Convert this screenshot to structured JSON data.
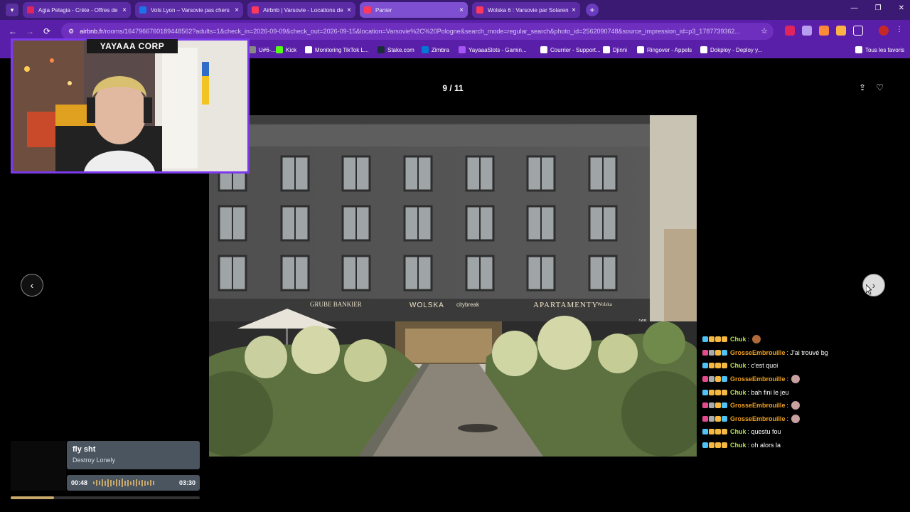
{
  "tabs": [
    {
      "label": "Agia Pelagia - Crète - Offres de",
      "color": "#e0245e",
      "active": false
    },
    {
      "label": "Vols Lyon – Varsovie pas chers",
      "color": "#1a73e8",
      "active": false
    },
    {
      "label": "Airbnb | Varsovie - Locations de",
      "color": "#ff385c",
      "active": false
    },
    {
      "label": "Panier",
      "color": "#ff385c",
      "active": true
    },
    {
      "label": "Wolska 6 : Varsovie par Solaren",
      "color": "#ff385c",
      "active": false
    }
  ],
  "toolbar": {
    "url_host": "airbnb.fr",
    "url_path": "/rooms/1647966760189448562?adults=1&check_in=2026-09-09&check_out=2026-09-15&location=Varsovie%2C%20Pologne&search_mode=regular_search&photo_id=2562090748&source_impression_id=p3_1787739362..."
  },
  "bookmarks": [
    {
      "label": "U#6-...",
      "color": "#888888"
    },
    {
      "label": "Kick",
      "color": "#53fc18"
    },
    {
      "label": "Monitoring TikTok L...",
      "color": "#ffffff"
    },
    {
      "label": "Stake.com",
      "color": "#1a2c38"
    },
    {
      "label": "Zimbra",
      "color": "#0078d4"
    },
    {
      "label": "YayaaaSlots - Gamin...",
      "color": "#a855f7"
    },
    {
      "label": "Courrier - Support...",
      "color": "#ffffff"
    },
    {
      "label": "Djinni",
      "color": "#ffffff"
    },
    {
      "label": "Ringover - Appels",
      "color": "#ffffff"
    },
    {
      "label": "Dokploy - Deploy y...",
      "color": "#ffffff"
    },
    {
      "label": "Tous les favoris",
      "color": "#ffffff"
    }
  ],
  "viewer": {
    "counter": "9 / 11",
    "prev_icon": "‹",
    "next_icon": "›"
  },
  "photo": {
    "signs": [
      "GRUBE BANKIER",
      "WOLSKA",
      "citybreak",
      "APARTAMENTY",
      "Wolska",
      "165"
    ]
  },
  "stream": {
    "cam_title": "YAYAAA CORP",
    "chat": [
      {
        "user": "Chuk",
        "text": ":",
        "emote": true
      },
      {
        "user": "GrosseEmbrouille",
        "text": ": J'ai trouvé bg",
        "emote": false
      },
      {
        "user": "Chuk",
        "text": ": c'est quoi",
        "emote": false
      },
      {
        "user": "GrosseEmbrouille",
        "text": ":",
        "emote": true
      },
      {
        "user": "Chuk",
        "text": ": bah fini le jeu",
        "emote": false
      },
      {
        "user": "GrosseEmbrouille",
        "text": ":",
        "emote": true
      },
      {
        "user": "GrosseEmbrouille",
        "text": ":",
        "emote": true
      },
      {
        "user": "Chuk",
        "text": ": questu fou",
        "emote": false
      },
      {
        "user": "Chuk",
        "text": ": oh alors la",
        "emote": false
      }
    ],
    "music": {
      "song": "fly sht",
      "artist": "Destroy Lonely",
      "current": "00:48",
      "total": "03:30",
      "progress": 0.23
    }
  }
}
